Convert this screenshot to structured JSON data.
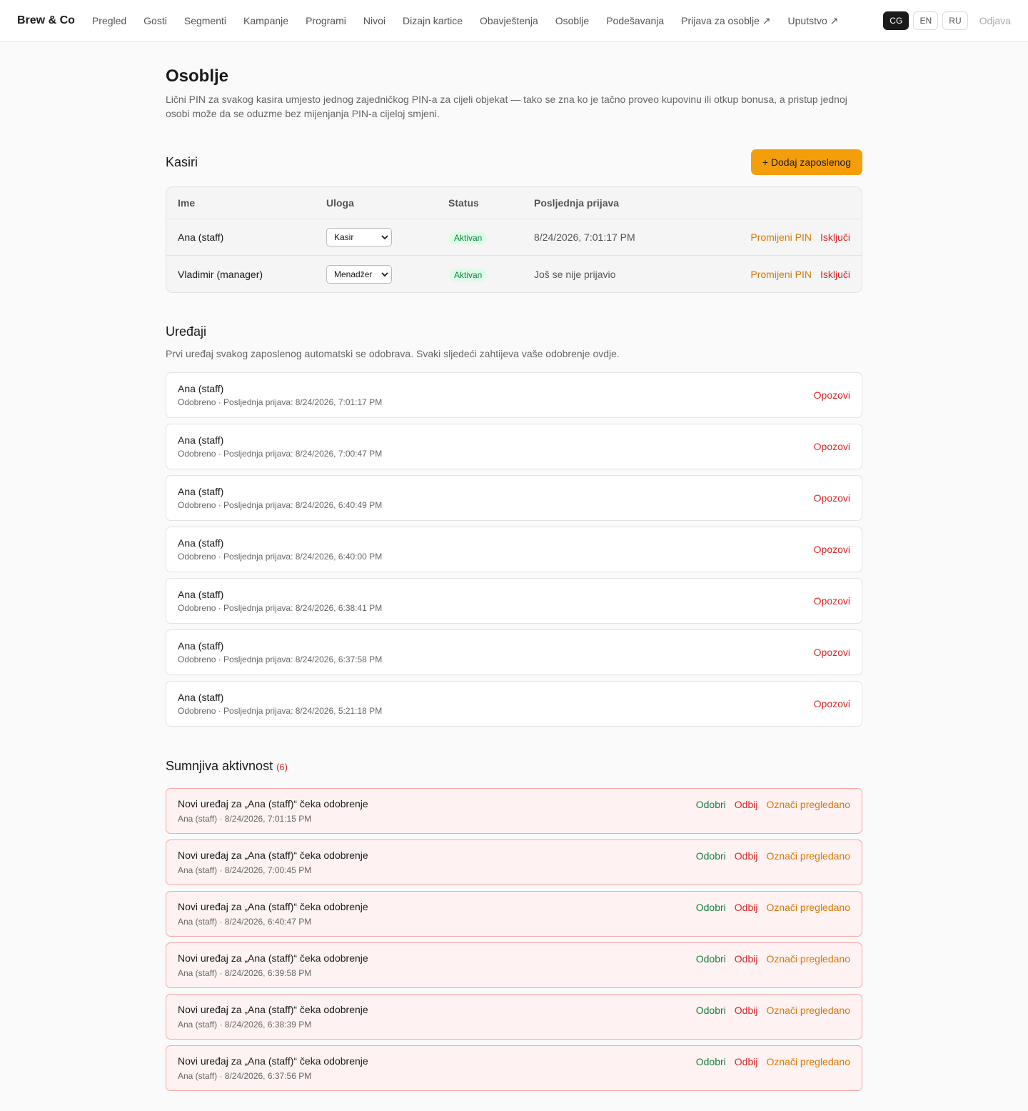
{
  "brand": "Brew & Co",
  "nav": [
    "Pregled",
    "Gosti",
    "Segmenti",
    "Kampanje",
    "Programi",
    "Nivoi",
    "Dizajn kartice",
    "Obavještenja",
    "Osoblje",
    "Podešavanja",
    "Prijava za osoblje ↗",
    "Uputstvo ↗"
  ],
  "langs": [
    "CG",
    "EN",
    "RU"
  ],
  "active_lang": "CG",
  "logout": "Odjava",
  "title": "Osoblje",
  "intro": "Lični PIN za svakog kasira umjesto jednog zajedničkog PIN-a za cijeli objekat — tako se zna ko je tačno proveo kupovinu ili otkup bonusa, a pristup jednoj osobi može da se oduzme bez mijenjanja PIN-a cijeloj smjeni.",
  "cashiers": {
    "heading": "Kasiri",
    "add_button": "+ Dodaj zaposlenog",
    "columns": [
      "Ime",
      "Uloga",
      "Status",
      "Posljednja prijava"
    ],
    "rows": [
      {
        "name": "Ana (staff)",
        "role": "Kasir",
        "status": "Aktivan",
        "last_login": "8/24/2026, 7:01:17 PM",
        "change_pin": "Promijeni PIN",
        "disable": "Isključi"
      },
      {
        "name": "Vladimir (manager)",
        "role": "Menadžer",
        "status": "Aktivan",
        "last_login": "Još se nije prijavio",
        "change_pin": "Promijeni PIN",
        "disable": "Isključi"
      }
    ]
  },
  "devices": {
    "heading": "Uređaji",
    "description": "Prvi uređaj svakog zaposlenog automatski se odobrava. Svaki sljedeći zahtijeva vaše odobrenje ovdje.",
    "revoke_label": "Opozovi",
    "items": [
      {
        "name": "Ana (staff)",
        "meta": "Odobreno · Posljednja prijava: 8/24/2026, 7:01:17 PM"
      },
      {
        "name": "Ana (staff)",
        "meta": "Odobreno · Posljednja prijava: 8/24/2026, 7:00:47 PM"
      },
      {
        "name": "Ana (staff)",
        "meta": "Odobreno · Posljednja prijava: 8/24/2026, 6:40:49 PM"
      },
      {
        "name": "Ana (staff)",
        "meta": "Odobreno · Posljednja prijava: 8/24/2026, 6:40:00 PM"
      },
      {
        "name": "Ana (staff)",
        "meta": "Odobreno · Posljednja prijava: 8/24/2026, 6:38:41 PM"
      },
      {
        "name": "Ana (staff)",
        "meta": "Odobreno · Posljednja prijava: 8/24/2026, 6:37:58 PM"
      },
      {
        "name": "Ana (staff)",
        "meta": "Odobreno · Posljednja prijava: 8/24/2026, 5:21:18 PM"
      }
    ]
  },
  "suspicious": {
    "heading": "Sumnjiva aktivnost",
    "count": "(6)",
    "approve": "Odobri",
    "reject": "Odbij",
    "mark_reviewed": "Označi pregledano",
    "items": [
      {
        "title": "Novi uređaj za „Ana (staff)“ čeka odobrenje",
        "meta": "Ana (staff) · 8/24/2026, 7:01:15 PM"
      },
      {
        "title": "Novi uređaj za „Ana (staff)“ čeka odobrenje",
        "meta": "Ana (staff) · 8/24/2026, 7:00:45 PM"
      },
      {
        "title": "Novi uređaj za „Ana (staff)“ čeka odobrenje",
        "meta": "Ana (staff) · 8/24/2026, 6:40:47 PM"
      },
      {
        "title": "Novi uređaj za „Ana (staff)“ čeka odobrenje",
        "meta": "Ana (staff) · 8/24/2026, 6:39:58 PM"
      },
      {
        "title": "Novi uređaj za „Ana (staff)“ čeka odobrenje",
        "meta": "Ana (staff) · 8/24/2026, 6:38:39 PM"
      },
      {
        "title": "Novi uređaj za „Ana (staff)“ čeka odobrenje",
        "meta": "Ana (staff) · 8/24/2026, 6:37:56 PM"
      }
    ]
  },
  "colors": {
    "accent": "#f59e0b",
    "danger": "#dc2626",
    "success": "#15803d",
    "alert_bg": "#fef2f2"
  }
}
